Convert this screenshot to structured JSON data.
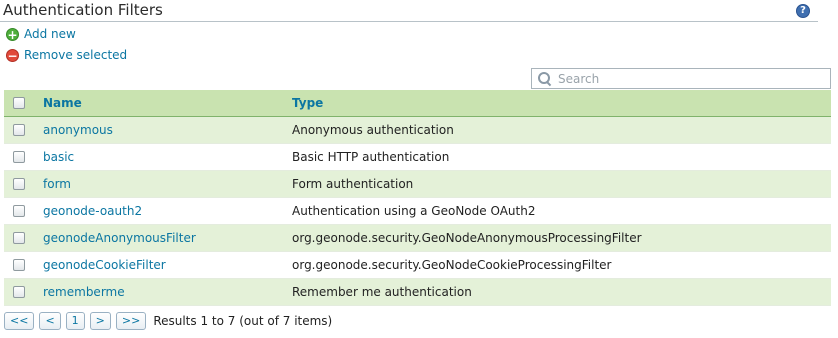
{
  "page": {
    "title": "Authentication Filters",
    "help_label": "?"
  },
  "actions": {
    "add_label": "Add new",
    "remove_label": "Remove selected"
  },
  "search": {
    "placeholder": "Search"
  },
  "table": {
    "columns": {
      "name": "Name",
      "type": "Type"
    },
    "rows": [
      {
        "name": "anonymous",
        "type": "Anonymous authentication"
      },
      {
        "name": "basic",
        "type": "Basic HTTP authentication"
      },
      {
        "name": "form",
        "type": "Form authentication"
      },
      {
        "name": "geonode-oauth2",
        "type": "Authentication using a GeoNode OAuth2"
      },
      {
        "name": "geonodeAnonymousFilter",
        "type": "org.geonode.security.GeoNodeAnonymousProcessingFilter"
      },
      {
        "name": "geonodeCookieFilter",
        "type": "org.geonode.security.GeoNodeCookieProcessingFilter"
      },
      {
        "name": "rememberme",
        "type": "Remember me authentication"
      }
    ]
  },
  "pager": {
    "first": "<<",
    "prev": "<",
    "page": "1",
    "next": ">",
    "last": ">>",
    "info": "Results 1 to 7 (out of 7 items)"
  },
  "colors": {
    "accent": "#0b76a2",
    "header_bg": "#c9e3b0",
    "odd_row_bg": "#e4f1d8"
  }
}
